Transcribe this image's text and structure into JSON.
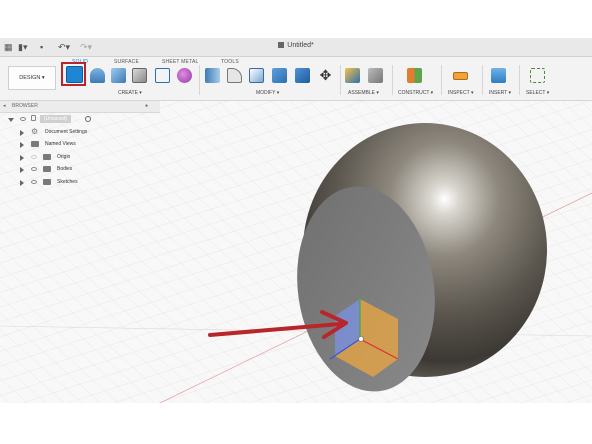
{
  "window": {
    "title": "Untitled*"
  },
  "workspace": {
    "label": "DESIGN"
  },
  "tabs": [
    "SOLID",
    "SURFACE",
    "SHEET METAL",
    "TOOLS"
  ],
  "groups": [
    "CREATE",
    "MODIFY",
    "ASSEMBLE",
    "CONSTRUCT",
    "INSPECT",
    "INSERT",
    "SELECT"
  ],
  "browser": {
    "title": "BROWSER",
    "root": "(Unsaved)",
    "items": [
      "Document Settings",
      "Named Views",
      "Origin",
      "Bodies",
      "Sketches"
    ]
  },
  "icons": [
    "grid-icon",
    "file-icon",
    "save-icon",
    "undo-icon",
    "redo-icon",
    "new-sketch-icon",
    "extrude-icon",
    "revolve-icon",
    "box-icon",
    "sketch-icon",
    "form-icon",
    "press-pull-icon",
    "fillet-icon",
    "shell-icon",
    "combine-icon",
    "align-icon",
    "move-icon",
    "joint-icon",
    "as-built-joint-icon",
    "offset-plane-icon",
    "measure-icon",
    "insert-image-icon",
    "select-window-icon",
    "visibility-eye-icon",
    "settings-gear-icon",
    "folder-icon",
    "arrow-annotation-icon"
  ],
  "colors": {
    "highlight": "#b8262c",
    "accent": "#1a7ac4",
    "sketch_fill": "#d9a04a"
  }
}
